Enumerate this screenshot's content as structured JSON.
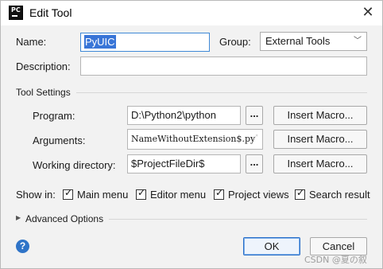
{
  "window": {
    "title": "Edit Tool",
    "app_icon_text": "PC",
    "close_glyph": "✕"
  },
  "form": {
    "name_label": "Name:",
    "name_value": "PyUIC",
    "group_label": "Group:",
    "group_value": "External Tools",
    "description_label": "Description:",
    "description_value": ""
  },
  "tool_settings": {
    "title": "Tool Settings",
    "program_label": "Program:",
    "program_value": "D:\\Python2\\python",
    "arguments_label": "Arguments:",
    "arguments_value": "NameWithoutExtension$.py",
    "working_dir_label": "Working directory:",
    "working_dir_value": "$ProjectFileDir$",
    "browse_label": "...",
    "insert_macro_label": "Insert Macro..."
  },
  "show_in": {
    "label": "Show in:",
    "options": [
      {
        "label": "Main menu",
        "checked": true
      },
      {
        "label": "Editor menu",
        "checked": true
      },
      {
        "label": "Project views",
        "checked": true
      },
      {
        "label": "Search result",
        "checked": true
      }
    ]
  },
  "advanced": {
    "label": "Advanced Options",
    "expanded": false
  },
  "footer": {
    "ok_label": "OK",
    "cancel_label": "Cancel",
    "help_glyph": "?"
  },
  "watermark": "CSDN @夏の叙",
  "icons": {
    "app": "pycharm-icon",
    "close": "close-icon",
    "dropdown": "chevron-down-icon",
    "help": "help-icon",
    "expand": "triangle-right-icon",
    "check": "checkmark-icon"
  },
  "colors": {
    "selection": "#3875d7",
    "focus_border": "#3f89d6",
    "help": "#2f74c8"
  }
}
